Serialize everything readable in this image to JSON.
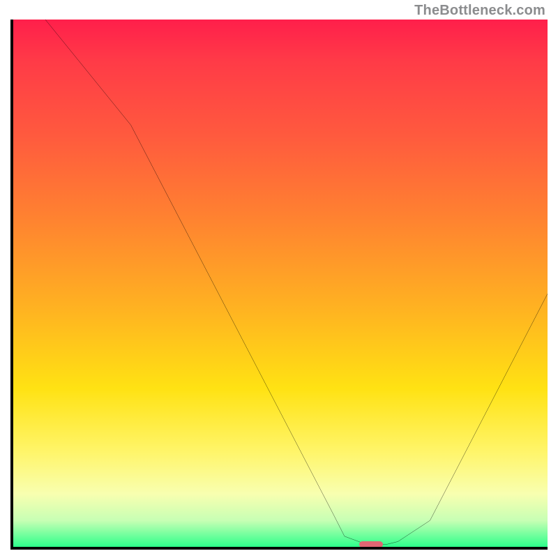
{
  "attribution": "TheBottleneck.com",
  "chart_data": {
    "type": "line",
    "title": "",
    "xlabel": "",
    "ylabel": "",
    "xlim": [
      0,
      100
    ],
    "ylim": [
      0,
      100
    ],
    "x": [
      0,
      6,
      22,
      60,
      62,
      66,
      70,
      72,
      78,
      100
    ],
    "values": [
      110,
      100,
      80,
      6,
      2,
      0.5,
      0.5,
      1,
      5,
      48
    ],
    "note": "Values are percentages read off a qualitative gradient background (red=high mismatch near 100, green=optimal near 0). Curve minimum (optimal point) is roughly at x≈66–70.",
    "marker": {
      "x": 67,
      "y": 0.5,
      "width_frac": 0.045,
      "height_frac": 0.012
    },
    "background_gradient_stops": [
      {
        "pct": 0,
        "color": "#ff1f4b"
      },
      {
        "pct": 8,
        "color": "#ff3b47"
      },
      {
        "pct": 22,
        "color": "#ff5a3e"
      },
      {
        "pct": 38,
        "color": "#ff8330"
      },
      {
        "pct": 55,
        "color": "#ffb321"
      },
      {
        "pct": 70,
        "color": "#ffe213"
      },
      {
        "pct": 82,
        "color": "#fff56a"
      },
      {
        "pct": 90,
        "color": "#f8ffb0"
      },
      {
        "pct": 95,
        "color": "#c7ffb4"
      },
      {
        "pct": 100,
        "color": "#2dff8b"
      }
    ]
  }
}
